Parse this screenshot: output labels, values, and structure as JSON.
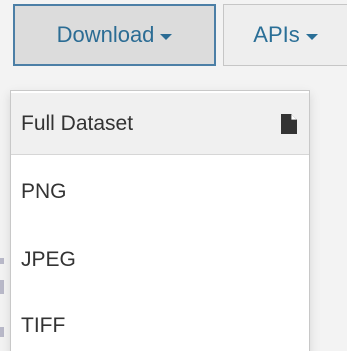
{
  "toolbar": {
    "download_label": "Download",
    "apis_label": "APIs"
  },
  "menu": {
    "header_label": "Full Dataset",
    "header_icon": "file-icon",
    "items": [
      {
        "label": "PNG"
      },
      {
        "label": "JPEG"
      },
      {
        "label": "TIFF"
      }
    ]
  },
  "colors": {
    "accent": "#2b6c94",
    "border_active": "#4c7fa6"
  }
}
